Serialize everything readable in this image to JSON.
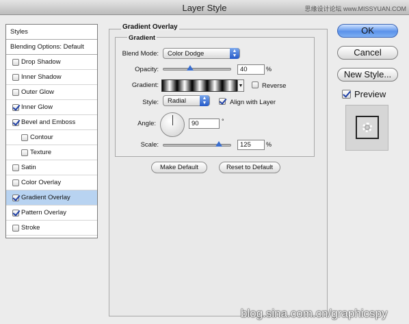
{
  "window": {
    "title": "Layer Style",
    "watermark_top": "思缘设计论坛 www.MISSYUAN.COM",
    "watermark_bottom": "blog.sina.com.cn/graphicspy"
  },
  "left_panel": {
    "items": [
      {
        "label": "Styles",
        "type": "header",
        "checked": false
      },
      {
        "label": "Blending Options: Default",
        "type": "header",
        "checked": false
      },
      {
        "label": "Drop Shadow",
        "type": "check",
        "checked": false
      },
      {
        "label": "Inner Shadow",
        "type": "check",
        "checked": false
      },
      {
        "label": "Outer Glow",
        "type": "check",
        "checked": false
      },
      {
        "label": "Inner Glow",
        "type": "check",
        "checked": true
      },
      {
        "label": "Bevel and Emboss",
        "type": "check",
        "checked": true
      },
      {
        "label": "Contour",
        "type": "indent",
        "checked": false
      },
      {
        "label": "Texture",
        "type": "indent",
        "checked": false
      },
      {
        "label": "Satin",
        "type": "check",
        "checked": false
      },
      {
        "label": "Color Overlay",
        "type": "check",
        "checked": false
      },
      {
        "label": "Gradient Overlay",
        "type": "check",
        "checked": true,
        "selected": true
      },
      {
        "label": "Pattern Overlay",
        "type": "check",
        "checked": true
      },
      {
        "label": "Stroke",
        "type": "check",
        "checked": false
      }
    ]
  },
  "main": {
    "section_title": "Gradient Overlay",
    "group_title": "Gradient",
    "blend_mode_label": "Blend Mode:",
    "blend_mode_value": "Color Dodge",
    "opacity_label": "Opacity:",
    "opacity_value": "40",
    "opacity_unit": "%",
    "gradient_label": "Gradient:",
    "reverse_label": "Reverse",
    "reverse_checked": false,
    "style_label": "Style:",
    "style_value": "Radial",
    "align_label": "Align with Layer",
    "align_checked": true,
    "angle_label": "Angle:",
    "angle_value": "90",
    "angle_unit": "°",
    "scale_label": "Scale:",
    "scale_value": "125",
    "scale_unit": "%",
    "make_default_label": "Make Default",
    "reset_default_label": "Reset to Default"
  },
  "right_panel": {
    "ok_label": "OK",
    "cancel_label": "Cancel",
    "new_style_label": "New Style...",
    "preview_label": "Preview",
    "preview_checked": true
  },
  "colors": {
    "accent": "#3a6fd0",
    "selection": "#b8d3f1"
  },
  "icons": [
    "checkmark-icon",
    "popup-arrow-icon",
    "slider-thumb-icon",
    "angle-dial-icon"
  ]
}
